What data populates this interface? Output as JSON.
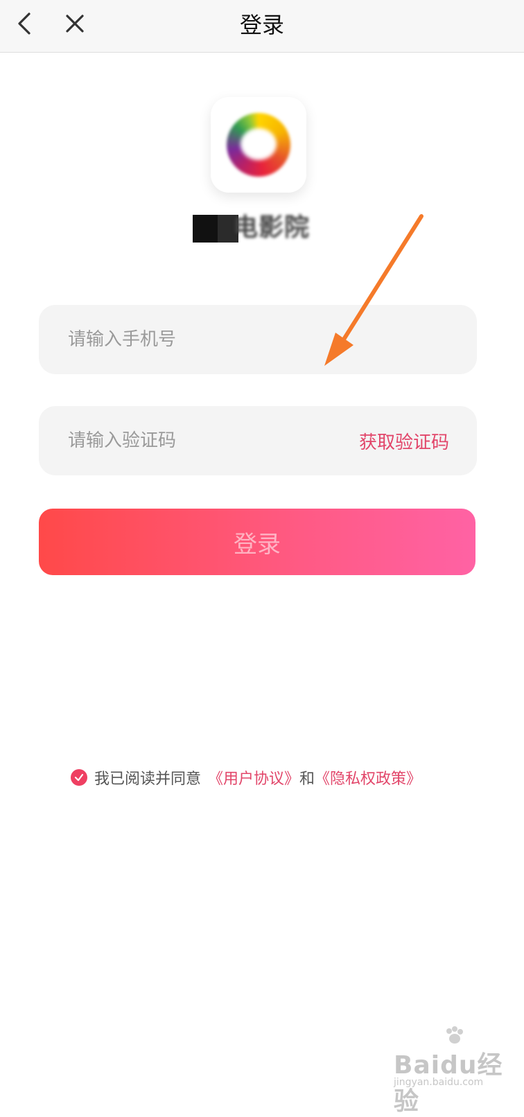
{
  "topbar": {
    "title": "登录",
    "back_icon": "chevron-left-icon",
    "close_icon": "close-icon"
  },
  "brand": {
    "name": "电影院"
  },
  "form": {
    "phone_placeholder": "请输入手机号",
    "code_placeholder": "请输入验证码",
    "get_code_label": "获取验证码",
    "login_label": "登录"
  },
  "agreement": {
    "checked": true,
    "prefix": "我已阅读并同意",
    "user_agreement": "《用户协议》",
    "and": "和",
    "privacy_policy": "《隐私权政策》"
  },
  "watermark": {
    "main": "Baidu经验",
    "sub": "jingyan.baidu.com"
  },
  "colors": {
    "accent": "#e2466a",
    "button_start": "#ff4949",
    "button_end": "#ff62a4",
    "arrow": "#f57a2a"
  }
}
